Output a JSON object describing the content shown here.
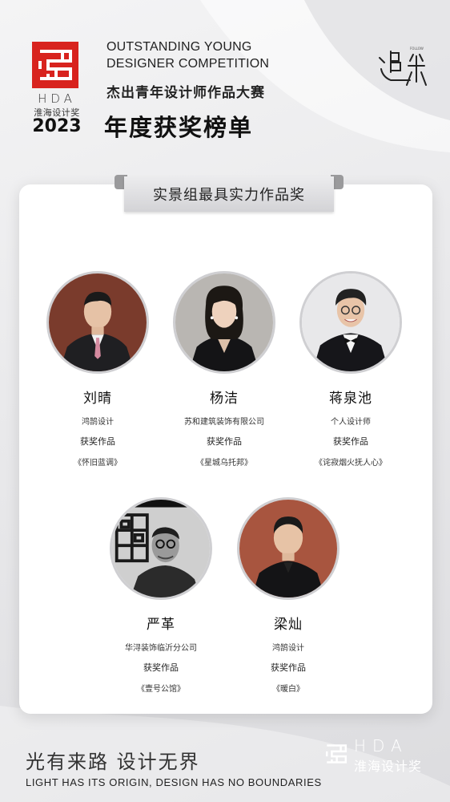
{
  "header": {
    "logo_letters": "HDA",
    "logo_cn": "淮海设计奖",
    "logo_year": "2023",
    "title_en_line1": "OUTSTANDING YOUNG",
    "title_en_line2": "DESIGNER COMPETITION",
    "title_cn": "杰出青年设计师作品大赛",
    "title_main": "年度获奖榜单"
  },
  "award": {
    "category": "实景组最具实力作品奖"
  },
  "winners": [
    {
      "name": "刘晴",
      "company": "鸿鹄设计",
      "label": "获奖作品",
      "work": "《怀旧蓝调》"
    },
    {
      "name": "杨洁",
      "company": "苏和建筑装饰有限公司",
      "label": "获奖作品",
      "work": "《星城乌托邦》"
    },
    {
      "name": "蒋泉池",
      "company": "个人设计师",
      "label": "获奖作品",
      "work": "《诧寂烟火抚人心》"
    },
    {
      "name": "严革",
      "company": "华浔装饰临沂分公司",
      "label": "获奖作品",
      "work": "《壹号公馆》"
    },
    {
      "name": "梁灿",
      "company": "鸿鹄设计",
      "label": "获奖作品",
      "work": "《暖白》"
    }
  ],
  "footer": {
    "slogan_cn": "光有来路 设计无界",
    "slogan_en": "LIGHT HAS ITS ORIGIN, DESIGN HAS NO BOUNDARIES",
    "logo_letters": "HDA",
    "logo_cn": "淮海设计奖"
  },
  "colors": {
    "brand_red": "#d8231e",
    "background": "#ebebed",
    "card": "#ffffff"
  }
}
